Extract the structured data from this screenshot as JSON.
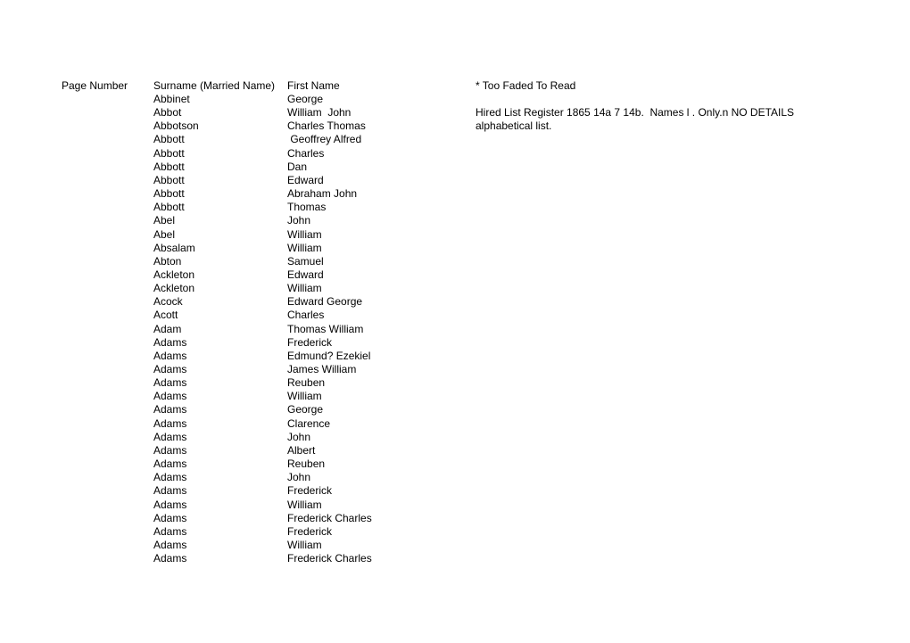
{
  "header": {
    "page_number": "Page Number",
    "surname": "Surname (Married Name)",
    "first_name": "First Name",
    "note": "* Too Faded To Read"
  },
  "notes": [
    "Hired List Register 1865 14a 7 14b.  Names l . Only.n NO DETAILS",
    "alphabetical list."
  ],
  "rows": [
    {
      "page": "",
      "surname": "Abbinet",
      "first_name": "George"
    },
    {
      "page": "",
      "surname": "Abbot",
      "first_name": "William  John"
    },
    {
      "page": "",
      "surname": "Abbotson",
      "first_name": "Charles Thomas"
    },
    {
      "page": "",
      "surname": "Abbott",
      "first_name": " Geoffrey Alfred"
    },
    {
      "page": "",
      "surname": "Abbott",
      "first_name": "Charles"
    },
    {
      "page": "",
      "surname": "Abbott",
      "first_name": "Dan"
    },
    {
      "page": "",
      "surname": "Abbott",
      "first_name": "Edward"
    },
    {
      "page": "",
      "surname": "Abbott",
      "first_name": "Abraham John"
    },
    {
      "page": "",
      "surname": "Abbott",
      "first_name": "Thomas"
    },
    {
      "page": "",
      "surname": "Abel",
      "first_name": "John"
    },
    {
      "page": "",
      "surname": "Abel",
      "first_name": "William"
    },
    {
      "page": "",
      "surname": "Absalam",
      "first_name": "William"
    },
    {
      "page": "",
      "surname": "Abton",
      "first_name": "Samuel"
    },
    {
      "page": "",
      "surname": "Ackleton",
      "first_name": "Edward"
    },
    {
      "page": "",
      "surname": "Ackleton",
      "first_name": "William"
    },
    {
      "page": "",
      "surname": "Acock",
      "first_name": "Edward George"
    },
    {
      "page": "",
      "surname": "Acott",
      "first_name": "Charles"
    },
    {
      "page": "",
      "surname": "Adam",
      "first_name": "Thomas William"
    },
    {
      "page": "",
      "surname": "Adams",
      "first_name": "Frederick"
    },
    {
      "page": "",
      "surname": "Adams",
      "first_name": "Edmund? Ezekiel"
    },
    {
      "page": "",
      "surname": "Adams",
      "first_name": "James William"
    },
    {
      "page": "",
      "surname": "Adams",
      "first_name": "Reuben"
    },
    {
      "page": "",
      "surname": "Adams",
      "first_name": "William"
    },
    {
      "page": "",
      "surname": "Adams",
      "first_name": "George"
    },
    {
      "page": "",
      "surname": "Adams",
      "first_name": "Clarence"
    },
    {
      "page": "",
      "surname": "Adams",
      "first_name": "John"
    },
    {
      "page": "",
      "surname": "Adams",
      "first_name": "Albert"
    },
    {
      "page": "",
      "surname": "Adams",
      "first_name": "Reuben"
    },
    {
      "page": "",
      "surname": "Adams",
      "first_name": "John"
    },
    {
      "page": "",
      "surname": "Adams",
      "first_name": "Frederick"
    },
    {
      "page": "",
      "surname": "Adams",
      "first_name": "William"
    },
    {
      "page": "",
      "surname": "Adams",
      "first_name": "Frederick Charles"
    },
    {
      "page": "",
      "surname": "Adams",
      "first_name": "Frederick"
    },
    {
      "page": "",
      "surname": "Adams",
      "first_name": "William"
    },
    {
      "page": "",
      "surname": "Adams",
      "first_name": "Frederick Charles"
    }
  ]
}
